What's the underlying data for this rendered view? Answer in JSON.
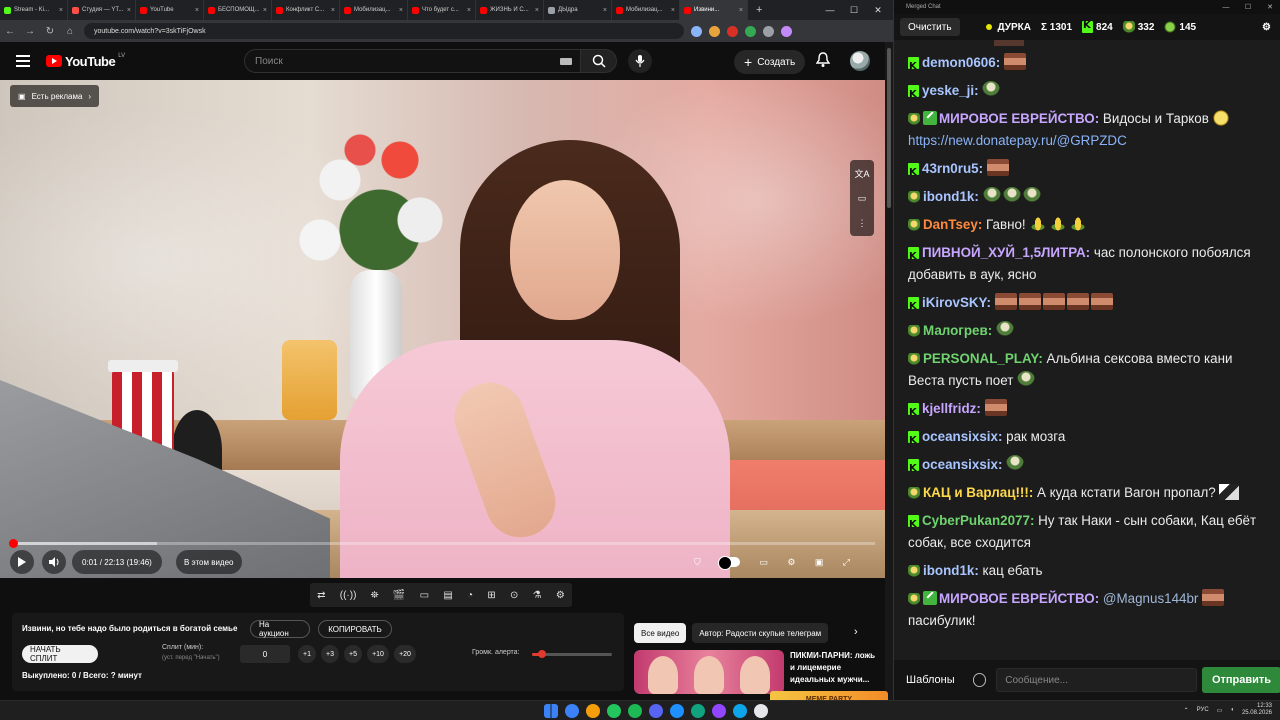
{
  "browser": {
    "tabs": [
      {
        "label": "Stream - Ki...",
        "color": "#53fc18",
        "active": false
      },
      {
        "label": "Студия — YT...",
        "color": "#ff4e45",
        "active": false
      },
      {
        "label": "YouTube",
        "color": "#ff0000",
        "active": false
      },
      {
        "label": "БЕСПОМОЩ...",
        "color": "#ff0000",
        "active": false
      },
      {
        "label": "Конфликт С...",
        "color": "#ff0000",
        "active": false
      },
      {
        "label": "Мобилизац...",
        "color": "#ff0000",
        "active": false
      },
      {
        "label": "Что будет с...",
        "color": "#ff0000",
        "active": false
      },
      {
        "label": "ЖИЗНЬ И С...",
        "color": "#ff0000",
        "active": false
      },
      {
        "label": "ДЫдра",
        "color": "#9aa0a6",
        "active": false
      },
      {
        "label": "Мобилизац...",
        "color": "#ff0000",
        "active": false
      },
      {
        "label": "Извини...",
        "color": "#ff0000",
        "active": true
      }
    ],
    "url": "youtube.com/watch?v=3skTiFjOwsk"
  },
  "youtube": {
    "logo_word": "YouTube",
    "country": "LV",
    "search_placeholder": "Поиск",
    "create_label": "Создать"
  },
  "video": {
    "ad_badge": "Есть реклама",
    "time": "0:01 / 22:13 (19:46)",
    "in_this_video": "В этом видео",
    "played_fraction": 0.003,
    "loaded_fraction": 0.17
  },
  "extension_toolbar": [
    "⇄",
    "((·))",
    "⛯",
    "🎬",
    "▭",
    "▤",
    "◔",
    "⊞",
    "⊙",
    "⚗",
    "⚙"
  ],
  "auction": {
    "title": "Извини, но тебе надо было родиться в богатой семье",
    "on_auction": "На аукцион",
    "copy": "КОПИРОВАТЬ",
    "start_split": "НАЧАТЬ СПЛИТ",
    "split_label": "Сплит (мин):",
    "split_sub": "(уст. перед \"Начать\")",
    "split_value": "0",
    "increments": [
      "+1",
      "+3",
      "+5",
      "+10",
      "+20"
    ],
    "alert_volume_label": "Громк. алерта:",
    "alert_volume": 0.12,
    "bought": "Выкуплено: 0 / Всего: ? минут"
  },
  "recommendations": {
    "chips": [
      "Все видео",
      "Автор: Радости скупые телеграм"
    ],
    "video_title": "ПИКМИ-ПАРНИ: ложь и лицемерие идеальных мужчи...",
    "meme_party": "MEME PARTY"
  },
  "chat": {
    "window_title": "Merged Chat",
    "clear_button": "Очистить",
    "status_name": "ДУРКА",
    "total": "Σ 1301",
    "kick_count": "824",
    "twitch_count": "332",
    "other_count": "145",
    "messages": [
      {
        "platform": "kick",
        "nick": "demon0606",
        "color": "#a9c5ff",
        "text": "",
        "emotes": [
          "face"
        ]
      },
      {
        "platform": "kick",
        "nick": "yeske_ji",
        "color": "#a9c5ff",
        "text": "",
        "emotes": [
          "pepe"
        ]
      },
      {
        "platform": "twitch",
        "mod": true,
        "nick": "МИРОВОЕ ЕВРЕЙСТВО",
        "color": "#c7a6ff",
        "text": "Видосы и Тарков",
        "emotes_after": [
          "yellow"
        ],
        "link": "https://new.donatepay.ru/@GRPZDC"
      },
      {
        "platform": "kick",
        "nick": "43rn0ru5",
        "color": "#a9c5ff",
        "text": "",
        "emotes": [
          "face"
        ]
      },
      {
        "platform": "twitch",
        "nick": "ibond1k",
        "color": "#a9c5ff",
        "text": "",
        "emotes": [
          "pepe",
          "pepe",
          "pepe"
        ]
      },
      {
        "platform": "twitch",
        "nick": "DanTsey",
        "color": "#ff8a3d",
        "text": "Гавно!",
        "emotes_after": [
          "corn",
          "corn",
          "corn"
        ]
      },
      {
        "platform": "kick",
        "nick": "ПИВНОЙ_ХУЙ_1,5ЛИТРА",
        "color": "#c7a6ff",
        "text": "час полонского побоялся добавить в аук, ясно"
      },
      {
        "platform": "kick",
        "nick": "iKirovSKY",
        "color": "#a9c5ff",
        "text": "",
        "emotes": [
          "face",
          "face",
          "face",
          "face",
          "face"
        ]
      },
      {
        "platform": "twitch",
        "nick": "Малогрев",
        "color": "#6fd46f",
        "text": "",
        "emotes": [
          "pepe"
        ]
      },
      {
        "platform": "twitch",
        "nick": "PERSONAL_PLAY",
        "color": "#6fd46f",
        "text": "Альбина сексова  вместо кани Веста пусть поет",
        "emotes_after": [
          "pepe"
        ]
      },
      {
        "platform": "kick",
        "nick": "kjellfridz",
        "color": "#c7a6ff",
        "text": "",
        "emotes": [
          "face"
        ]
      },
      {
        "platform": "kick",
        "nick": "oceansixsix",
        "color": "#a9c5ff",
        "text": "рак мозга"
      },
      {
        "platform": "kick",
        "nick": "oceansixsix",
        "color": "#a9c5ff",
        "text": "",
        "emotes": [
          "pepe"
        ]
      },
      {
        "platform": "twitch",
        "nick": "КАЦ и Варлац!!!",
        "color": "#ffd84a",
        "text": "А куда кстати Вагон пропал?",
        "emotes_after": [
          "dogimg"
        ]
      },
      {
        "platform": "kick",
        "nick": "CyberPukan2077",
        "color": "#6fd46f",
        "text": "Ну так Наки - сын собаки, Кац ебёт собак, все сходится"
      },
      {
        "platform": "twitch",
        "nick": "ibond1k",
        "color": "#a9c5ff",
        "text": "кац ебать"
      },
      {
        "platform": "twitch",
        "mod": true,
        "nick": "МИРОВОЕ ЕВРЕЙСТВО",
        "color": "#c7a6ff",
        "mention": "@Magnus144br",
        "text": "пасибулик!",
        "emotes_mid": [
          "face"
        ]
      }
    ],
    "templates": "Шаблоны",
    "input_placeholder": "Сообщение...",
    "send": "Отправить"
  },
  "taskbar": {
    "icons": [
      "#3b82f6",
      "#f59e0b",
      "#22c55e",
      "#1db954",
      "#5865f2",
      "#1e90ff",
      "#10a37f",
      "#9146ff",
      "#0ea5e9",
      "#e5e7eb"
    ],
    "lang": "РУС",
    "time": "12:33",
    "date": "25.08.2026"
  }
}
